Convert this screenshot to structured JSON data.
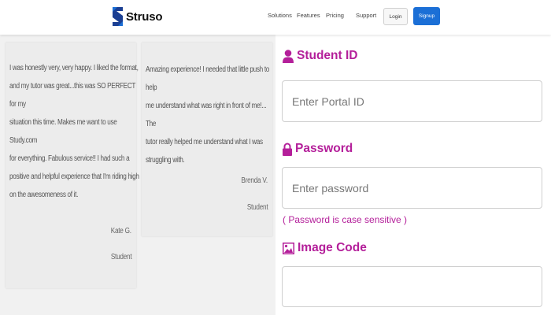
{
  "brand": {
    "name": "Struso",
    "icon": "struso-logo-icon",
    "color": "#1b6fd6"
  },
  "nav": {
    "links": [
      "Solutions",
      "Features",
      "Pricing",
      "Support"
    ],
    "login_label": "Login",
    "signup_label": "Signup"
  },
  "testimonials": [
    {
      "lines": [
        "I was honestly very, very happy. I liked the format,",
        "and my tutor was great...this was SO PERFECT for my",
        "situation this time. Makes me want to use Study.com",
        "for everything. Fabulous service!! I had such a",
        "positive and helpful experience that I'm riding high",
        "on the awesomeness of it."
      ],
      "name": "Kate G.",
      "role": "Student"
    },
    {
      "lines": [
        "Amazing experience! I needed that little push to help",
        "me understand what was right in front of me!... The",
        "tutor really helped me understand what I was",
        "struggling with."
      ],
      "name": "Brenda V.",
      "role": "Student"
    }
  ],
  "form": {
    "accent_color": "#b41f9a",
    "student_id": {
      "label": "Student ID",
      "placeholder": "Enter Portal ID",
      "value": "",
      "icon": "user-icon"
    },
    "password": {
      "label": "Password",
      "placeholder": "Enter password",
      "value": "",
      "hint": "( Password is case sensitive )",
      "icon": "lock-icon"
    },
    "image_code": {
      "label": "Image Code",
      "placeholder": "",
      "value": "",
      "icon": "image-icon"
    }
  }
}
